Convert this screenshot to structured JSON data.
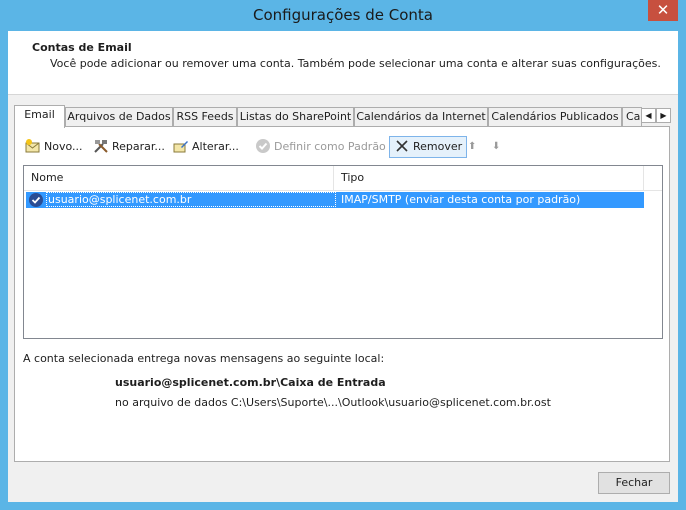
{
  "window": {
    "title": "Configurações de Conta",
    "close_glyph": "✕"
  },
  "header": {
    "title": "Contas de Email",
    "description": "Você pode adicionar ou remover uma conta. Também pode selecionar uma conta e alterar suas configurações."
  },
  "tabs": [
    {
      "label": "Email",
      "active": true
    },
    {
      "label": "Arquivos de Dados"
    },
    {
      "label": "RSS Feeds"
    },
    {
      "label": "Listas do SharePoint"
    },
    {
      "label": "Calendários da Internet"
    },
    {
      "label": "Calendários Publicados"
    },
    {
      "label": "Ca"
    }
  ],
  "tab_scroll": {
    "left": "◀",
    "right": "▶"
  },
  "toolbar": {
    "new_label": "Novo...",
    "repair_label": "Reparar...",
    "change_label": "Alterar...",
    "default_label": "Definir como Padrão",
    "remove_label": "Remover",
    "up_glyph": "⬆",
    "down_glyph": "⬇"
  },
  "list": {
    "columns": [
      "Nome",
      "Tipo"
    ],
    "rows": [
      {
        "name": "usuario@splicenet.com.br",
        "type": "IMAP/SMTP (enviar desta conta por padrão)",
        "selected": true
      }
    ]
  },
  "info": {
    "line": "A conta selecionada entrega novas mensagens ao seguinte local:",
    "location": "usuario@splicenet.com.br\\Caixa de Entrada",
    "file": "no arquivo de dados C:\\Users\\Suporte\\...\\Outlook\\usuario@splicenet.com.br.ost"
  },
  "footer": {
    "close_label": "Fechar"
  },
  "colors": {
    "titlebar": "#5bb5e6",
    "selection": "#3399ff",
    "close_button": "#c7503f"
  }
}
